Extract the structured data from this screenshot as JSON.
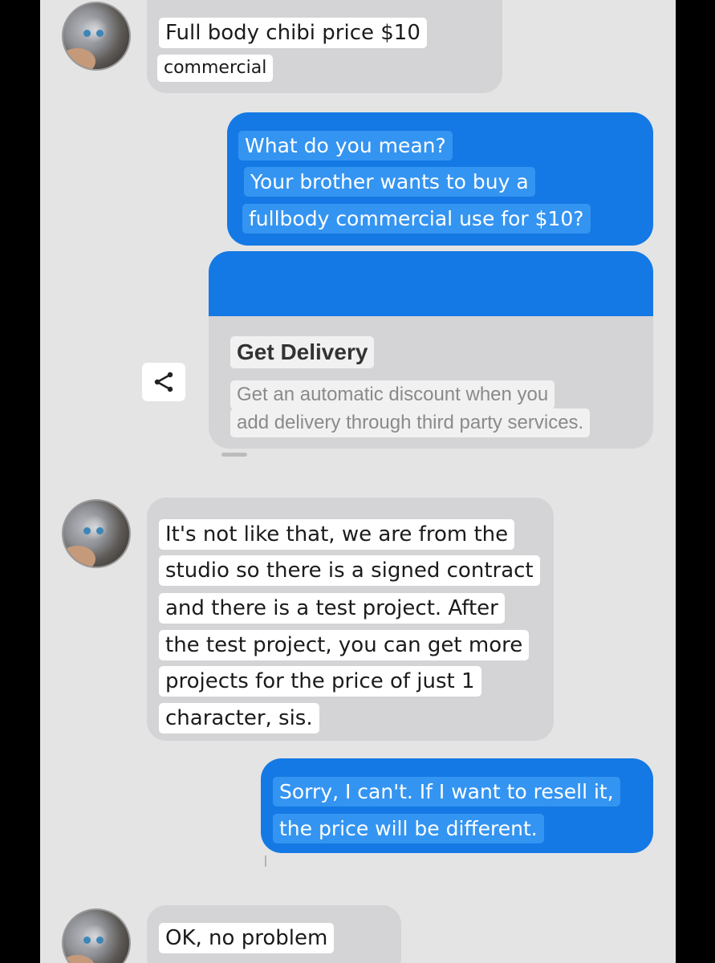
{
  "conversation": {
    "messages": [
      {
        "direction": "incoming",
        "avatar": "cat-avatar",
        "lines": [
          "Full body chibi price $10",
          "commercial"
        ]
      },
      {
        "direction": "outgoing",
        "lines": [
          "What do you mean?",
          "Your brother wants to buy a",
          "fullbody commercial use for $10?"
        ]
      },
      {
        "direction": "outgoing-card",
        "card": {
          "title": "Get Delivery",
          "description_lines": [
            "Get an automatic discount when you",
            "add delivery through third party services."
          ]
        },
        "action_icon": "share-icon"
      },
      {
        "direction": "incoming",
        "avatar": "cat-avatar",
        "lines": [
          "It's not like that, we are from the",
          "studio so there is a signed contract",
          "and there is a test project. After",
          "the test project, you can get more",
          "projects for the price of just 1",
          "character, sis."
        ]
      },
      {
        "direction": "outgoing",
        "lines": [
          "Sorry, I can't. If I want to resell it,",
          "the price will be different."
        ]
      },
      {
        "direction": "incoming",
        "avatar": "cat-avatar",
        "lines": [
          "OK, no problem"
        ]
      }
    ]
  },
  "colors": {
    "outgoing_bubble": "#1479e4",
    "incoming_bubble": "#d4d4d6",
    "background": "#e4e4e5"
  }
}
